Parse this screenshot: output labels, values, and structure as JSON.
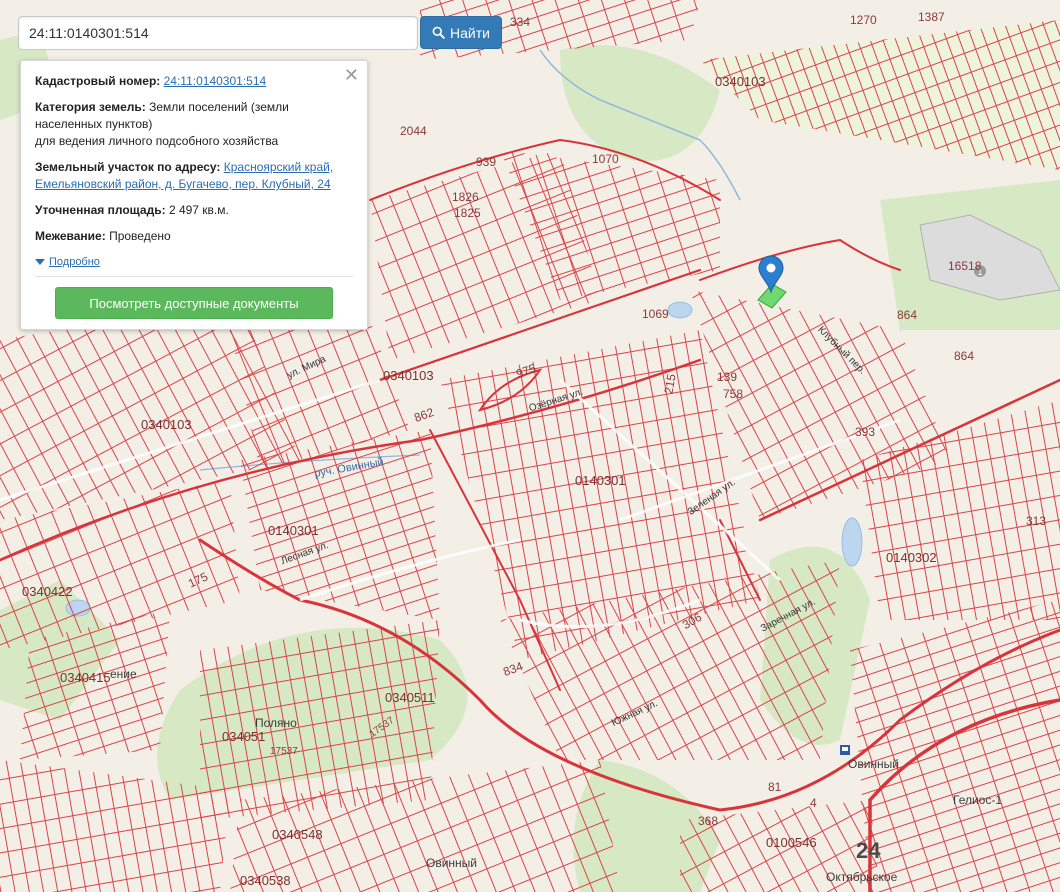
{
  "search": {
    "value": "24:11:0140301:514",
    "button_label": "Найти"
  },
  "popup": {
    "cadastral_key": "Кадастровый номер:",
    "cadastral_value": "24:11:0140301:514",
    "category_key": "Категория земель:",
    "category_value_1": "Земли поселений (земли",
    "category_value_2": "населенных пунктов)",
    "category_value_3": "для ведения личного подсобного хозяйства",
    "address_key": "Земельный участок по адресу:",
    "address_value_1": "Красноярский край,",
    "address_value_2": "Емельяновский район, д. Бугачево, пер. Клубный, 24",
    "area_key": "Уточненная площадь:",
    "area_value": "2 497 кв.м.",
    "survey_key": "Межевание:",
    "survey_value": "Проведено",
    "more_label": "Подробно",
    "docs_button": "Посмотреть доступные документы",
    "close_symbol": "✕"
  },
  "map": {
    "colors": {
      "background": "#f3efe6",
      "parcel_line": "#d9444a",
      "major_road": "#d8343c",
      "green": "#d7e9c4",
      "water": "#bcd6ef",
      "marker": "#2a7fcf",
      "selected_parcel": "#6fd86f"
    },
    "labels": {
      "l334": "334",
      "l1270": "1270",
      "l1387": "1387",
      "l0340103a": "0340103",
      "l2044": "2044",
      "l1070": "1070",
      "l939": "939",
      "l1826": "1826",
      "l1825": "1825",
      "l16518": "16518",
      "l1069": "1069",
      "l864a": "864",
      "l864b": "864",
      "l975": "975",
      "l862": "862",
      "l0340103b": "0340103",
      "l0340103c": "0340103",
      "l0140301a": "0140301",
      "l0140301b": "0140301",
      "l0140302": "0140302",
      "l0340422": "0340422",
      "l0340415": "0340415",
      "l0340511a": "0340511",
      "l0340511b": "034051",
      "l17537a": "17537",
      "l17537b": "17537",
      "l0340548": "0340548",
      "l0340538": "0340538",
      "l0100546": "0100546",
      "l24": "24",
      "l368": "368",
      "l81": "81",
      "l4": "4",
      "l313": "313",
      "l393": "393",
      "l139": "139",
      "l758": "758",
      "l215": "215",
      "l834": "834",
      "l306": "306",
      "l175": "175",
      "ovinny_creek": "руч. Овинный",
      "ovinny_place": "Овинный",
      "ovinny_place2": "Овинный",
      "poleno": "Поляно",
      "gelios": "Гелиос-1",
      "oktyabrskoe": "Октябрьское",
      "eniye": "ение",
      "ul_mira": "ул. Мира",
      "ozernaya": "Озёрная ул.",
      "zelenaya": "Зеленая ул.",
      "klubny": "Клубный пер.",
      "lesnaya": "Лесная ул.",
      "zarechnaya": "Заречная ул.",
      "yuzhnaya": "Южная ул."
    }
  }
}
